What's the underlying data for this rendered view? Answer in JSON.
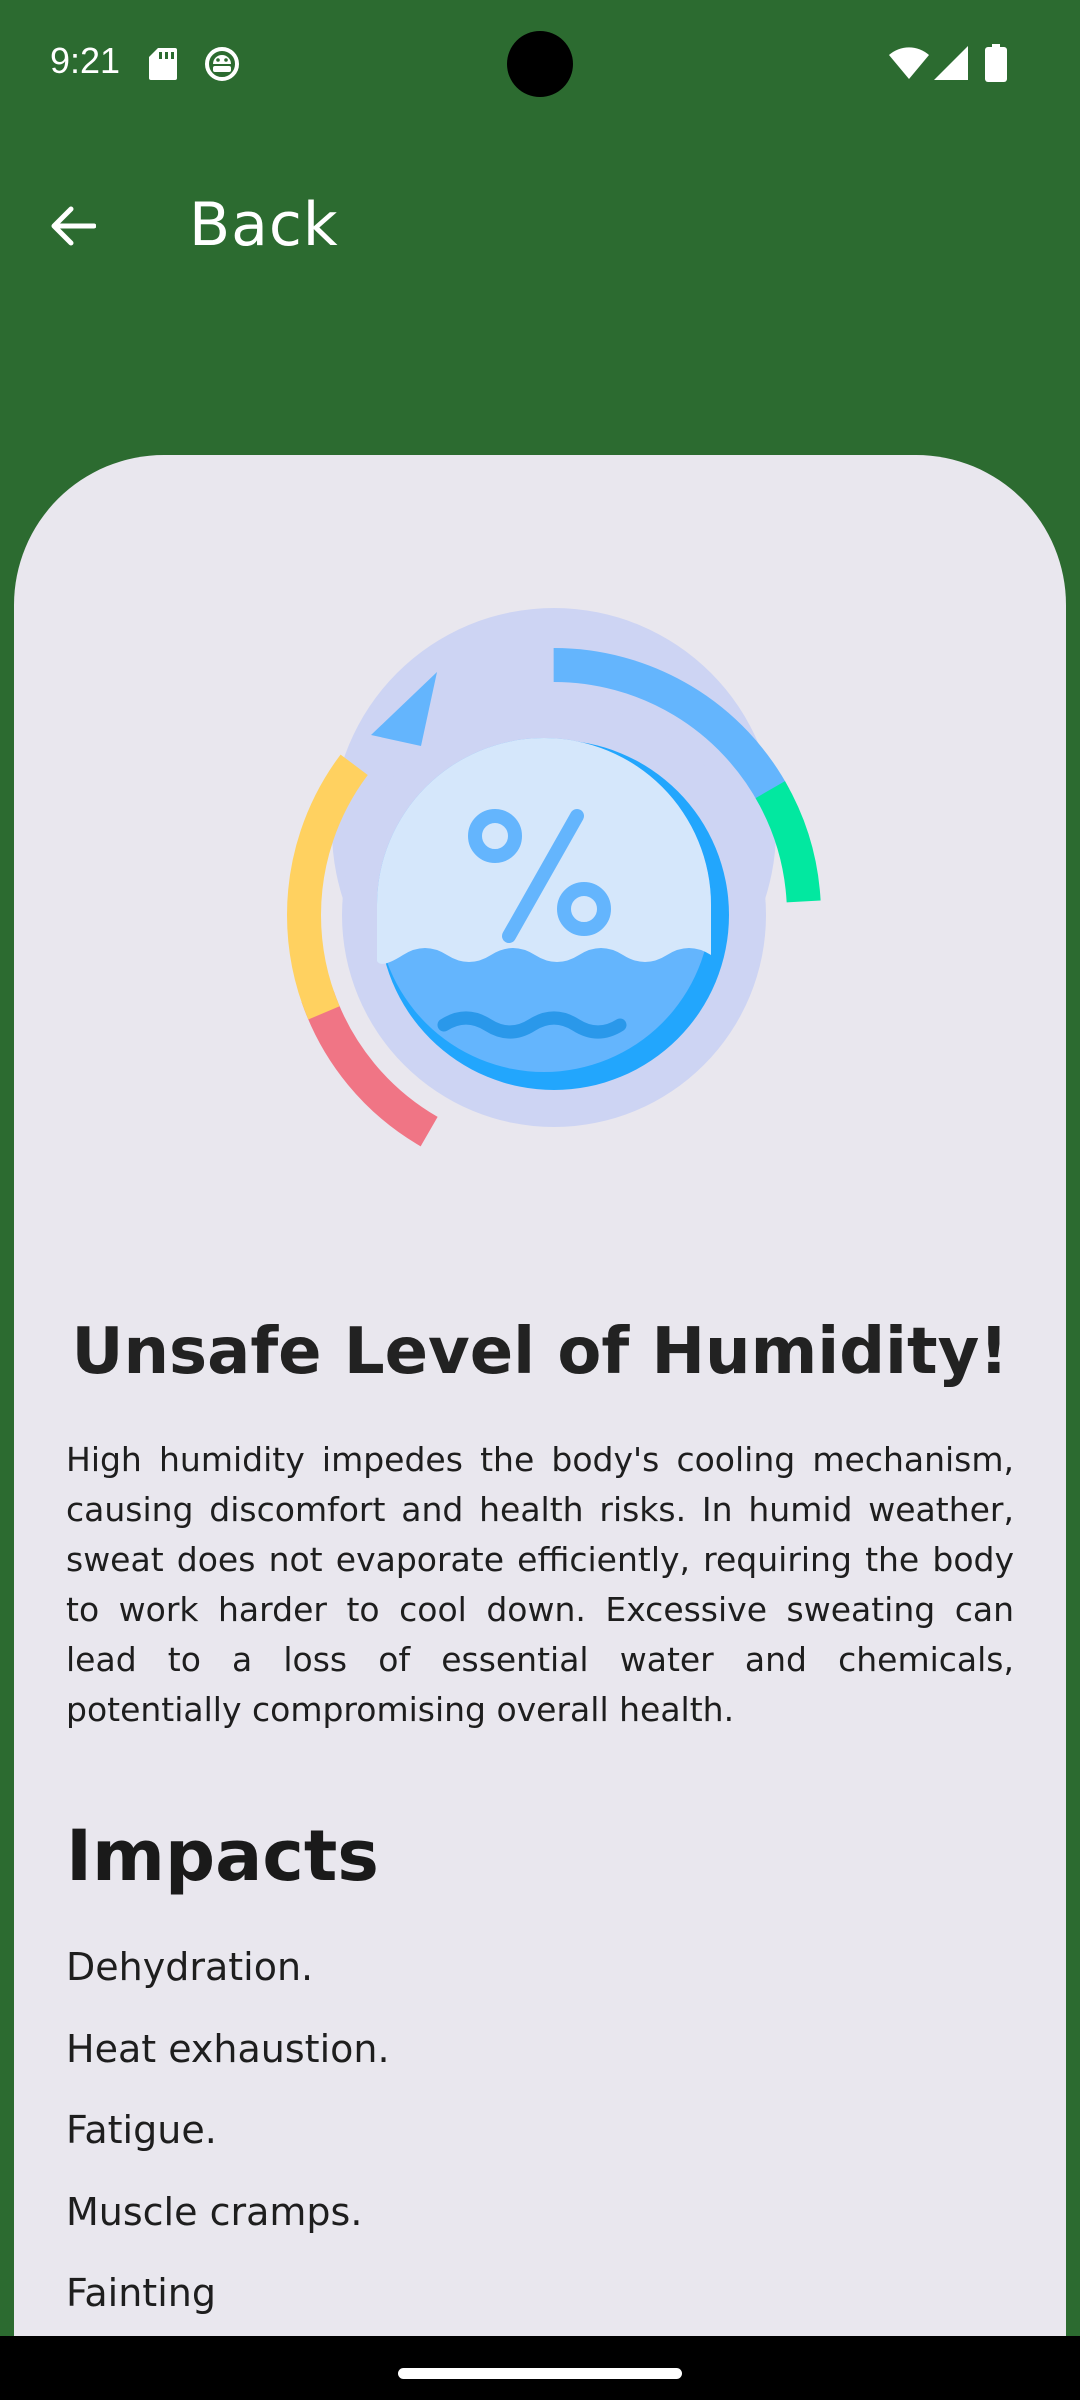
{
  "status_bar": {
    "time": "9:21"
  },
  "app_bar": {
    "title": "Back"
  },
  "content": {
    "headline": "Unsafe Level of Humidity!",
    "description": "High humidity impedes the body's cooling mechanism, causing discomfort and health risks. In humid weather, sweat does not evaporate efficiently, requiring the body to work harder to cool down. Excessive sweating can lead to a loss of essential water and chemicals, potentially compromising overall health.",
    "impacts_heading": "Impacts",
    "impacts": [
      "Dehydration.",
      "Heat exhaustion.",
      "Fatigue.",
      "Muscle cramps.",
      "Fainting"
    ]
  },
  "colors": {
    "app_bar_background": "#2c6b30",
    "card_background": "#e9e7ee",
    "gauge_red": "#f07585",
    "gauge_yellow": "#ffd160",
    "gauge_blue": "#64b5fd",
    "gauge_green": "#02e8a0",
    "water_blue": "#64b5fd"
  },
  "icons": {
    "back": "arrow-left-icon",
    "illustration": "humidity-gauge-icon"
  }
}
